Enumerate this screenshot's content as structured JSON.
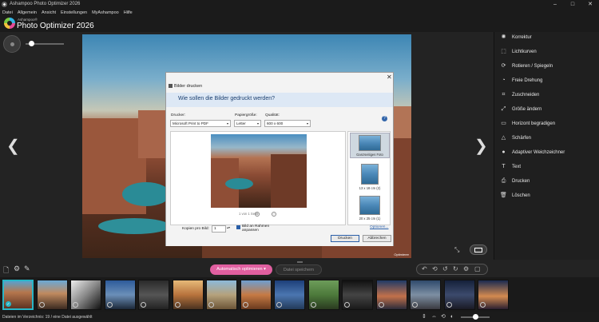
{
  "window": {
    "title": "Ashampoo Photo Optimizer 2026",
    "minimize": "–",
    "maximize": "□",
    "close": "✕"
  },
  "menu": [
    "Datei",
    "Allgemein",
    "Ansicht",
    "Einstellungen",
    "MyAshampoo",
    "Hilfe"
  ],
  "brand": {
    "small": "Ashampoo®",
    "name": "Photo Optimizer 2026"
  },
  "image_tag": "Optimierer",
  "nav": {
    "prev": "❮",
    "next": "❯"
  },
  "dialog": {
    "title": "Bilder drucken",
    "close": "✕",
    "question": "Wie sollen die Bilder gedruckt werden?",
    "printer_label": "Drucker:",
    "printer_value": "Microsoft Print to PDF",
    "paper_label": "Papiergröße:",
    "paper_value": "Letter",
    "quality_label": "Qualität:",
    "quality_value": "600 x 600",
    "help": "?",
    "page_info": "1 von 1 Seite",
    "prev_page": "‹",
    "next_page": "›",
    "layouts": [
      {
        "label": "Ganzseitiges Foto"
      },
      {
        "label": "13 x 18 cm (2)"
      },
      {
        "label": "20 x 25 cm (1)"
      }
    ],
    "copies_label": "Kopien pro Bild:",
    "copies_value": "1",
    "fit_label_1": "Bild an Rahmen",
    "fit_label_2": "anpassen",
    "options_link": "Optionen...",
    "print_button": "Drucken",
    "cancel_button": "Abbrechen"
  },
  "tools": [
    {
      "icon": "sun-icon",
      "glyph": "✺",
      "label": "Korrektur"
    },
    {
      "icon": "curves-icon",
      "glyph": "⬚",
      "label": "Lichtkurven"
    },
    {
      "icon": "rotate-icon",
      "glyph": "⟳",
      "label": "Rotieren / Spiegeln"
    },
    {
      "icon": "free-rotate-icon",
      "glyph": "◔",
      "label": "Freie Drehung"
    },
    {
      "icon": "crop-icon",
      "glyph": "⌗",
      "label": "Zuschneiden"
    },
    {
      "icon": "resize-icon",
      "glyph": "⤢",
      "label": "Größe ändern"
    },
    {
      "icon": "horizon-icon",
      "glyph": "▭",
      "label": "Horizont begradigen"
    },
    {
      "icon": "sharpen-icon",
      "glyph": "△",
      "label": "Schärfen"
    },
    {
      "icon": "blur-icon",
      "glyph": "●",
      "label": "Adaptiver Weichzeichner"
    },
    {
      "icon": "text-icon",
      "glyph": "T",
      "label": "Text"
    },
    {
      "icon": "printer-icon",
      "glyph": "⎙",
      "label": "Drucken"
    },
    {
      "icon": "trash-icon",
      "glyph": "🗑",
      "label": "Löschen"
    }
  ],
  "toolbar": {
    "auto_optimize": "Automatisch optimieren",
    "auto_optimize_arrow": "▾",
    "save_file": "Datei speichern"
  },
  "filmstrip_count": 15,
  "status": {
    "text": "Dateien im Verzeichnis: 19 / eine Datei ausgewählt"
  },
  "colors": {
    "accent": "#e05fa0",
    "selection": "#29b6c7"
  }
}
